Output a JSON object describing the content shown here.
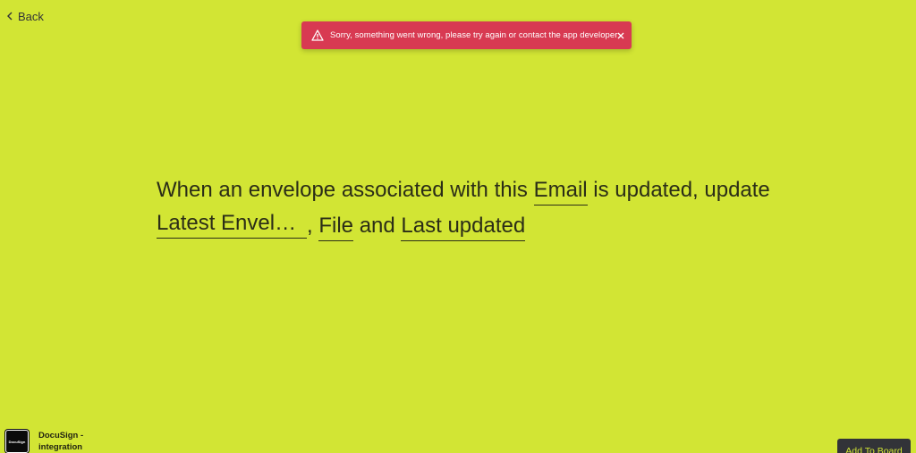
{
  "nav": {
    "back_label": "Back",
    "back_icon": "chevron-left-icon"
  },
  "toast": {
    "type": "error",
    "message": "Sorry, something went wrong, please try again or contact the app developer",
    "warning_icon": "warning-icon",
    "close_icon": "close-icon",
    "color": "#d83a52"
  },
  "sentence": {
    "part1": "When an envelope associated with this",
    "field_email": "Email",
    "part2": "is updated, update",
    "field_latest": "Latest Envelop…",
    "comma": ",",
    "field_file": "File",
    "and": "and",
    "field_last_updated": "Last updated"
  },
  "app": {
    "name": "DocuSign - integration",
    "logo_text": "DocuSign"
  },
  "actions": {
    "add_to_board": "Add To Board"
  },
  "colors": {
    "background": "#d2e534",
    "button": "#323338"
  }
}
